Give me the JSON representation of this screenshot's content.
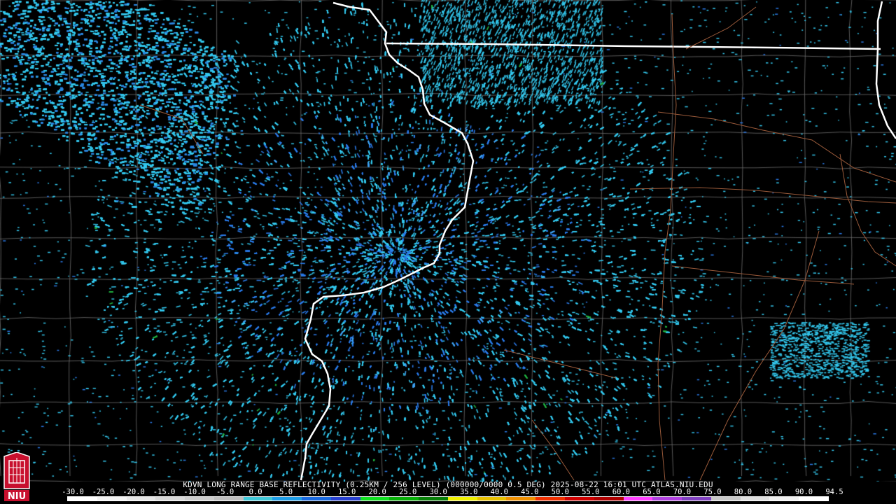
{
  "product": {
    "caption": "KDVN LONG RANGE BASE REFLECTIVITY (0.25KM / 256 LEVEL) (000000/0000 0.5 DEG) 2025-08-22 16:01 UTC  ATLAS.NIU.EDU"
  },
  "legend": {
    "tick_labels": [
      "-30.0",
      "-25.0",
      "-20.0",
      "-15.0",
      "-10.0",
      "-5.0",
      "0.0",
      "5.0",
      "10.0",
      "15.0",
      "20.0",
      "25.0",
      "30.0",
      "35.0",
      "40.0",
      "45.0",
      "50.0",
      "55.0",
      "60.0",
      "65.0",
      "70.0",
      "75.0",
      "80.0",
      "85.0",
      "90.0",
      "94.5"
    ],
    "colors": [
      "#ffffff",
      "#f2f2f2",
      "#e6e6e6",
      "#d8d8d8",
      "#cccccc",
      "#bfbfbf",
      "#40c8d8",
      "#1e9ee8",
      "#1a6ae0",
      "#2840d0",
      "#10e020",
      "#08b008",
      "#088008",
      "#f0f000",
      "#e8c000",
      "#f09000",
      "#f03000",
      "#d00000",
      "#b00000",
      "#ff40ff",
      "#b040e0",
      "#8040c0",
      "#c8c8c8",
      "#e0e0e0",
      "#f0f0f0",
      "#ffffff"
    ]
  },
  "logo": {
    "text": "NIU"
  },
  "colors": {
    "background": "#000000",
    "state_border": "#ffffff",
    "county_line": "#6e6e6e",
    "highway": "#9a5a3a",
    "echo_light": "#33c8ee",
    "echo_mid": "#2a7ae8",
    "echo_green": "#20b040",
    "logo_red": "#c8102e"
  }
}
